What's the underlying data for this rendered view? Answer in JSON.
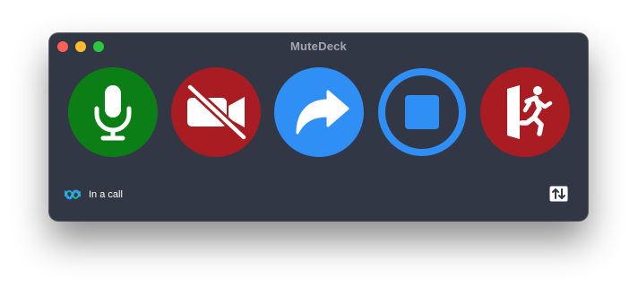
{
  "window": {
    "title": "MuteDeck"
  },
  "controls": [
    {
      "name": "microphone",
      "icon": "microphone-icon",
      "state": "unmuted",
      "color": "#0b7f16"
    },
    {
      "name": "video",
      "icon": "video-off-icon",
      "state": "off",
      "color": "#a81c22"
    },
    {
      "name": "share",
      "icon": "share-arrow-icon",
      "state": "inactive",
      "color": "#2f8ff5"
    },
    {
      "name": "record",
      "icon": "stop-record-icon",
      "state": "inactive",
      "color": "#2f8ff5"
    },
    {
      "name": "leave",
      "icon": "exit-door-icon",
      "state": "available",
      "color": "#a81c22"
    }
  ],
  "status": {
    "text": "In a call",
    "app_icon": "webex-icon"
  },
  "footer": {
    "toggle_icon": "swap-arrows-icon"
  }
}
